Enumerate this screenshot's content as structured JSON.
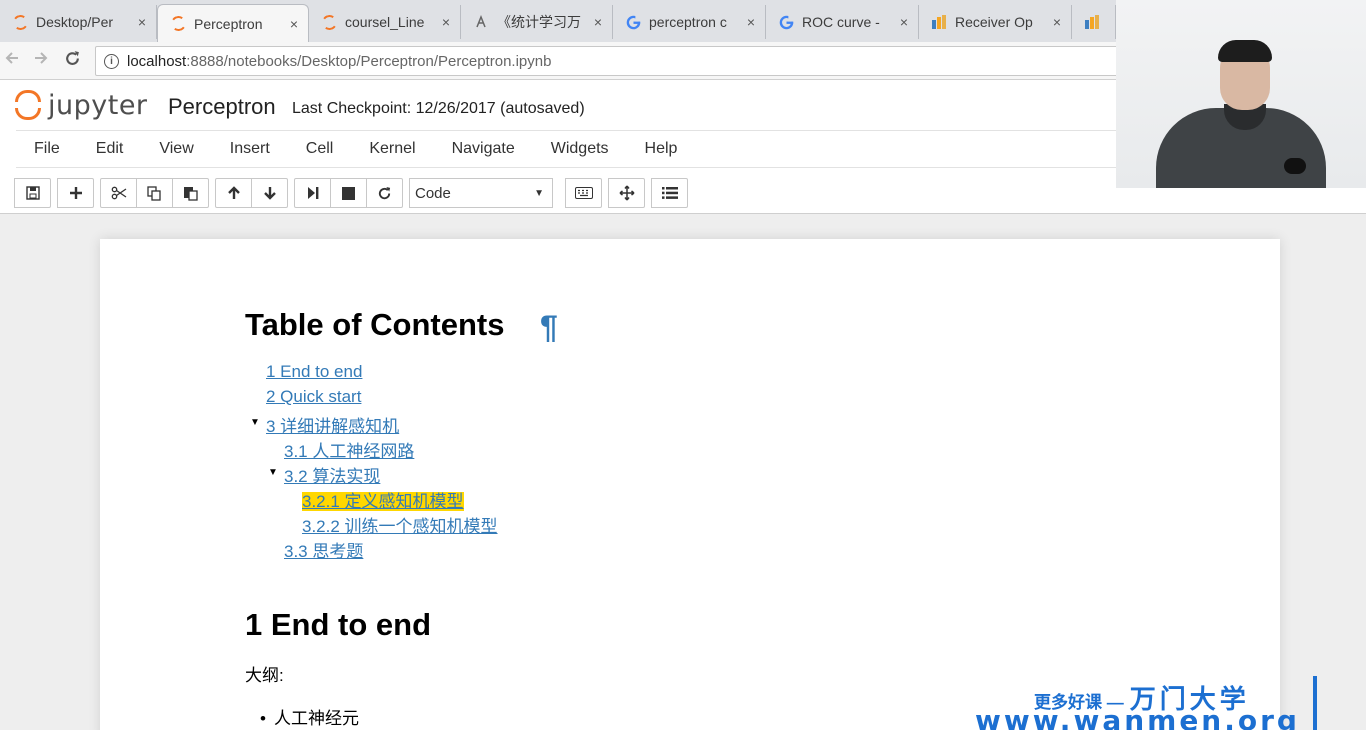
{
  "browser": {
    "tabs": [
      {
        "label": "Desktop/Per",
        "icon": "jupyter-icon",
        "active": false
      },
      {
        "label": "Perceptron",
        "icon": "jupyter-icon",
        "active": true
      },
      {
        "label": "coursel_Line",
        "icon": "jupyter-icon",
        "active": false
      },
      {
        "label": "《统计学习万",
        "icon": "page-icon",
        "active": false
      },
      {
        "label": "perceptron c",
        "icon": "google-icon",
        "active": false
      },
      {
        "label": "ROC curve -",
        "icon": "google-icon",
        "active": false
      },
      {
        "label": "Receiver Op",
        "icon": "wikipedia-icon",
        "active": false
      },
      {
        "label": "R",
        "icon": "wikipedia-icon",
        "active": false
      }
    ],
    "close_glyph": "×",
    "url_host": "localhost",
    "url_path": ":8888/notebooks/Desktop/Perceptron/Perceptron.ipynb",
    "info_glyph": "i"
  },
  "jupyter": {
    "logo_text": "jupyter",
    "notebook_name": "Perceptron",
    "checkpoint": "Last Checkpoint: 12/26/2017 (autosaved)",
    "menu": [
      "File",
      "Edit",
      "View",
      "Insert",
      "Cell",
      "Kernel",
      "Navigate",
      "Widgets",
      "Help"
    ],
    "cell_type": "Code"
  },
  "notebook": {
    "toc_title": "Table of Contents",
    "pilcrow": "¶",
    "toc": [
      {
        "label": "1  End to end"
      },
      {
        "label": "2  Quick start"
      },
      {
        "label": "3  详细讲解感知机"
      },
      {
        "label": "3.1  人工神经网路"
      },
      {
        "label": "3.2  算法实现"
      },
      {
        "label": "3.2.1  定义感知机模型",
        "highlighted": true
      },
      {
        "label": "3.2.2  训练一个感知机模型"
      },
      {
        "label": "3.3  思考题"
      }
    ],
    "section_heading": "1  End to end",
    "outline_label": "大纲:",
    "bullets": [
      "人工神经元"
    ]
  },
  "watermark": {
    "line1_small": "更多好课 —",
    "line1_big": "万门大学",
    "line2": "www.wanmen.org"
  },
  "colors": {
    "link": "#337ab7",
    "highlight": "#ffd700",
    "jupyter_orange": "#f37626",
    "watermark_blue": "#1c6fd1"
  }
}
